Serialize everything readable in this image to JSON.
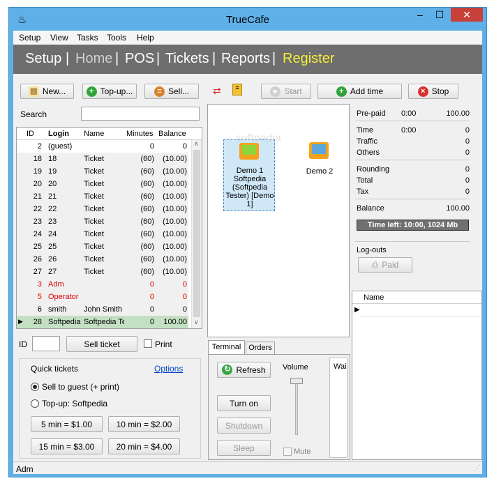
{
  "window": {
    "title": "TrueCafe",
    "minimize": "–",
    "maximize": "☐",
    "close": "✕"
  },
  "menu": [
    "Setup",
    "View",
    "Tasks",
    "Tools",
    "Help"
  ],
  "nav": {
    "items": [
      "Setup",
      "Home",
      "POS",
      "Tickets",
      "Reports",
      "Register"
    ],
    "separator": "|",
    "active": "Home"
  },
  "left_toolbar": {
    "new": "New...",
    "topup": "Top-up...",
    "sell": "Sell..."
  },
  "search": {
    "label": "Search",
    "value": ""
  },
  "accounts": {
    "columns": [
      "ID",
      "Login",
      "Name",
      "Minutes",
      "Balance"
    ],
    "rows": [
      {
        "id": "2",
        "login": "(guest)",
        "name": "",
        "minutes": "0",
        "balance": "0",
        "red": false
      },
      {
        "id": "18",
        "login": "18",
        "name": "Ticket",
        "minutes": "(60)",
        "balance": "(10.00)",
        "red": false
      },
      {
        "id": "19",
        "login": "19",
        "name": "Ticket",
        "minutes": "(60)",
        "balance": "(10.00)",
        "red": false
      },
      {
        "id": "20",
        "login": "20",
        "name": "Ticket",
        "minutes": "(60)",
        "balance": "(10.00)",
        "red": false
      },
      {
        "id": "21",
        "login": "21",
        "name": "Ticket",
        "minutes": "(60)",
        "balance": "(10.00)",
        "red": false
      },
      {
        "id": "22",
        "login": "22",
        "name": "Ticket",
        "minutes": "(60)",
        "balance": "(10.00)",
        "red": false
      },
      {
        "id": "23",
        "login": "23",
        "name": "Ticket",
        "minutes": "(60)",
        "balance": "(10.00)",
        "red": false
      },
      {
        "id": "24",
        "login": "24",
        "name": "Ticket",
        "minutes": "(60)",
        "balance": "(10.00)",
        "red": false
      },
      {
        "id": "25",
        "login": "25",
        "name": "Ticket",
        "minutes": "(60)",
        "balance": "(10.00)",
        "red": false
      },
      {
        "id": "26",
        "login": "26",
        "name": "Ticket",
        "minutes": "(60)",
        "balance": "(10.00)",
        "red": false
      },
      {
        "id": "27",
        "login": "27",
        "name": "Ticket",
        "minutes": "(60)",
        "balance": "(10.00)",
        "red": false
      },
      {
        "id": "3",
        "login": "Adm",
        "name": "",
        "minutes": "0",
        "balance": "0",
        "red": true
      },
      {
        "id": "5",
        "login": "Operator",
        "name": "",
        "minutes": "0",
        "balance": "0",
        "red": true
      },
      {
        "id": "6",
        "login": "smith",
        "name": "John Smith",
        "minutes": "0",
        "balance": "0",
        "red": false
      },
      {
        "id": "28",
        "login": "Softpedia",
        "name": "Softpedia Te",
        "minutes": "0",
        "balance": "100.00",
        "red": false,
        "selected": true
      }
    ]
  },
  "ticket": {
    "id_label": "ID",
    "id_value": "",
    "sell_button": "Sell ticket",
    "print_label": "Print",
    "print_checked": false
  },
  "quick_tickets": {
    "title": "Quick tickets",
    "options_link": "Options",
    "radio_sell": "Sell to guest (+ print)",
    "radio_topup": "Top-up: Softpedia",
    "selected": "sell",
    "buttons": [
      "5 min = $1.00",
      "10 min = $2.00",
      "15 min = $3.00",
      "20 min = $4.00"
    ]
  },
  "session_toolbar": {
    "start": "Start",
    "add_time": "Add time",
    "stop": "Stop"
  },
  "computers": [
    {
      "label": "Demo 1 Softpedia (Softpedia Tester) [Demo 1]",
      "selected": true
    },
    {
      "label": "Demo 2",
      "selected": false
    }
  ],
  "watermark": "softpedia",
  "terminal_tabs": {
    "tabs": [
      "Terminal",
      "Orders"
    ],
    "active": "Terminal"
  },
  "terminal": {
    "refresh": "Refresh",
    "turn_on": "Turn on",
    "shutdown": "Shutdown",
    "sleep": "Sleep",
    "volume_label": "Volume",
    "volume": 1.0,
    "mute_label": "Mute",
    "mute_checked": false,
    "wait_label": "Wai"
  },
  "billing": {
    "prepaid_label": "Pre-paid",
    "prepaid_time": "0:00",
    "prepaid_amount": "100.00",
    "time_label": "Time",
    "time_value": "0:00",
    "time_amount": "0",
    "traffic_label": "Traffic",
    "traffic_amount": "0",
    "others_label": "Others",
    "others_amount": "0",
    "rounding_label": "Rounding",
    "rounding_amount": "0",
    "total_label": "Total",
    "total_amount": "0",
    "tax_label": "Tax",
    "tax_amount": "0",
    "balance_label": "Balance",
    "balance_amount": "100.00",
    "time_left": "Time left: 10:00, 1024 Mb"
  },
  "logouts": {
    "title": "Log-outs",
    "paid_button": "Paid",
    "column": "Name"
  },
  "status": {
    "text": "Adm"
  },
  "colors": {
    "nav_bg": "#6e6e6e",
    "nav_active": "#f5ee3a",
    "window_frame": "#5fb0e8",
    "selected_row": "#c4e0c4",
    "red_row": "#e00000",
    "link": "#0044cc"
  }
}
